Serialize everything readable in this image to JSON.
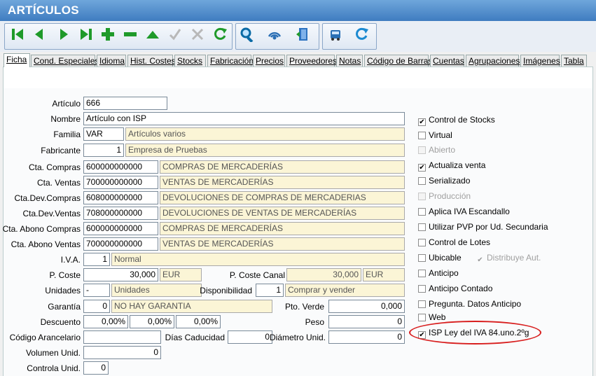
{
  "window": {
    "title": "ARTÍCULOS"
  },
  "tabs": [
    "Ficha",
    "Cond. Especiales",
    "Idioma",
    "Hist. Costes",
    "Stocks",
    "Fabricación",
    "Precios",
    "Proveedores",
    "Notas",
    "Código de Barras",
    "Cuentas",
    "Agrupaciones",
    "Imágenes",
    "Tabla"
  ],
  "toolbar_icons": [
    "first-icon",
    "prev-icon",
    "next-icon",
    "last-icon",
    "add-icon",
    "delete-icon",
    "up-icon",
    "confirm-icon",
    "cancel-icon",
    "refresh-icon",
    "search-icon",
    "wireless-icon",
    "exit-door-icon",
    "bus-icon",
    "sync-icon"
  ],
  "form": {
    "articulo": {
      "label": "Artículo",
      "value": "666"
    },
    "nombre": {
      "label": "Nombre",
      "value": "Artículo con ISP"
    },
    "familia": {
      "label": "Familia",
      "code": "VAR",
      "desc": "Artículos varios"
    },
    "fabricante": {
      "label": "Fabricante",
      "code": "1",
      "desc": "Empresa de Pruebas"
    },
    "cta_compras": {
      "label": "Cta. Compras",
      "code": "600000000000",
      "desc": "COMPRAS DE MERCADERÍAS"
    },
    "cta_ventas": {
      "label": "Cta. Ventas",
      "code": "700000000000",
      "desc": "VENTAS DE MERCADERÍAS"
    },
    "cta_dev_compras": {
      "label": "Cta.Dev.Compras",
      "code": "608000000000",
      "desc": "DEVOLUCIONES DE COMPRAS DE MERCADERIAS"
    },
    "cta_dev_ventas": {
      "label": "Cta.Dev.Ventas",
      "code": "708000000000",
      "desc": "DEVOLUCIONES DE VENTAS DE MERCADERÍAS"
    },
    "cta_abono_compras": {
      "label": "Cta. Abono Compras",
      "code": "600000000000",
      "desc": "COMPRAS DE MERCADERÍAS"
    },
    "cta_abono_ventas": {
      "label": "Cta. Abono Ventas",
      "code": "700000000000",
      "desc": "VENTAS DE MERCADERÍAS"
    },
    "iva": {
      "label": "I.V.A.",
      "code": "1",
      "desc": "Normal"
    },
    "p_coste": {
      "label": "P. Coste",
      "value": "30,000",
      "currency": "EUR"
    },
    "p_coste_canal": {
      "label": "P. Coste Canal",
      "value": "30,000",
      "currency": "EUR"
    },
    "unidades": {
      "label": "Unidades",
      "code": "-",
      "desc": "Unidades"
    },
    "disponibilidad": {
      "label": "Disponibilidad",
      "code": "1",
      "desc": "Comprar y vender"
    },
    "garantia": {
      "label": "Garantía",
      "code": "0",
      "desc": "NO HAY GARANTIA"
    },
    "pto_verde": {
      "label": "Pto. Verde",
      "value": "0,000"
    },
    "descuento": {
      "label": "Descuento",
      "values": [
        "0,00%",
        "0,00%",
        "0,00%"
      ]
    },
    "peso": {
      "label": "Peso",
      "value": "0"
    },
    "codigo_arancelario": {
      "label": "Código Arancelario",
      "value": ""
    },
    "dias_caducidad": {
      "label": "Días Caducidad",
      "value": "0"
    },
    "diametro_unid": {
      "label": "Diámetro Unid.",
      "value": "0"
    },
    "volumen_unid": {
      "label": "Volumen Unid.",
      "value": "0"
    },
    "controla_unid": {
      "label": "Controla Unid.",
      "value": "0"
    }
  },
  "checkboxes": [
    {
      "label": "Control de Stocks",
      "checked": true,
      "disabled": false
    },
    {
      "label": "Virtual",
      "checked": false,
      "disabled": false
    },
    {
      "label": "Abierto",
      "checked": false,
      "disabled": true
    },
    {
      "label": "Actualiza venta",
      "checked": true,
      "disabled": false
    },
    {
      "label": "Serializado",
      "checked": false,
      "disabled": false
    },
    {
      "label": "Producción",
      "checked": false,
      "disabled": true
    },
    {
      "label": "Aplica IVA Escandallo",
      "checked": false,
      "disabled": false
    },
    {
      "label": "Utilizar PVP por Ud. Secundaria",
      "checked": false,
      "disabled": false
    },
    {
      "label": "Control de Lotes",
      "checked": false,
      "disabled": false
    },
    {
      "label": "Ubicable",
      "checked": false,
      "disabled": false
    },
    {
      "label": "Anticipo",
      "checked": false,
      "disabled": false
    },
    {
      "label": "Anticipo Contado",
      "checked": false,
      "disabled": false
    },
    {
      "label": "Pregunta. Datos Anticipo",
      "checked": false,
      "disabled": false
    },
    {
      "label": "Web",
      "checked": false,
      "disabled": false
    },
    {
      "label": "ISP Ley del IVA 84.uno.2ºg",
      "checked": true,
      "disabled": false
    }
  ],
  "distribuye": {
    "label": "Distribuye Aut.",
    "checked": true,
    "disabled": true
  },
  "check_mark": "✔"
}
